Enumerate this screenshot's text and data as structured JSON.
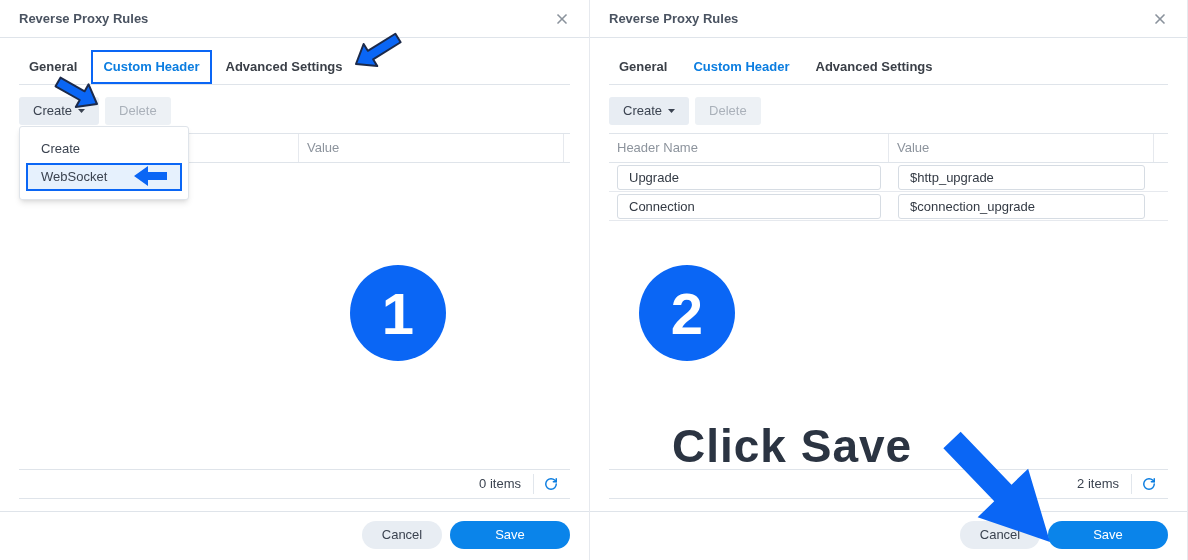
{
  "panels": [
    {
      "title": "Reverse Proxy Rules",
      "tabs": [
        {
          "label": "General",
          "selected": false,
          "outlined": false
        },
        {
          "label": "Custom Header",
          "selected": true,
          "outlined": true
        },
        {
          "label": "Advanced Settings",
          "selected": false,
          "outlined": false
        }
      ],
      "create_button": "Create",
      "delete_button": {
        "label": "Delete",
        "disabled": true
      },
      "menu": {
        "items": [
          {
            "label": "Create",
            "selected": false,
            "outlined": false
          },
          {
            "label": "WebSocket",
            "selected": true,
            "outlined": true
          }
        ]
      },
      "columns": [
        {},
        {
          "label": "Value"
        }
      ],
      "item_count": "0 items",
      "cancel_button": "Cancel",
      "save_button": "Save",
      "step": "1",
      "arrows": [
        {
          "kind": "create"
        },
        {
          "kind": "advanced"
        },
        {
          "kind": "menu_item"
        }
      ]
    },
    {
      "title": "Reverse Proxy Rules",
      "tabs": [
        {
          "label": "General",
          "selected": false,
          "outlined": false
        },
        {
          "label": "Custom Header",
          "selected": true,
          "outlined": false
        },
        {
          "label": "Advanced Settings",
          "selected": false,
          "outlined": false
        }
      ],
      "create_button": "Create",
      "delete_button": {
        "label": "Delete",
        "disabled": true
      },
      "columns": [
        {
          "label": "Header Name"
        },
        {
          "label": "Value"
        }
      ],
      "rows": [
        {
          "name": "Upgrade",
          "value": "$http_upgrade"
        },
        {
          "name": "Connection",
          "value": "$connection_upgrade"
        }
      ],
      "item_count": "2 items",
      "cancel_button": "Cancel",
      "save_button": "Save",
      "step": "2",
      "caption": "Click Save",
      "arrows": [
        {
          "kind": "save"
        }
      ]
    }
  ]
}
